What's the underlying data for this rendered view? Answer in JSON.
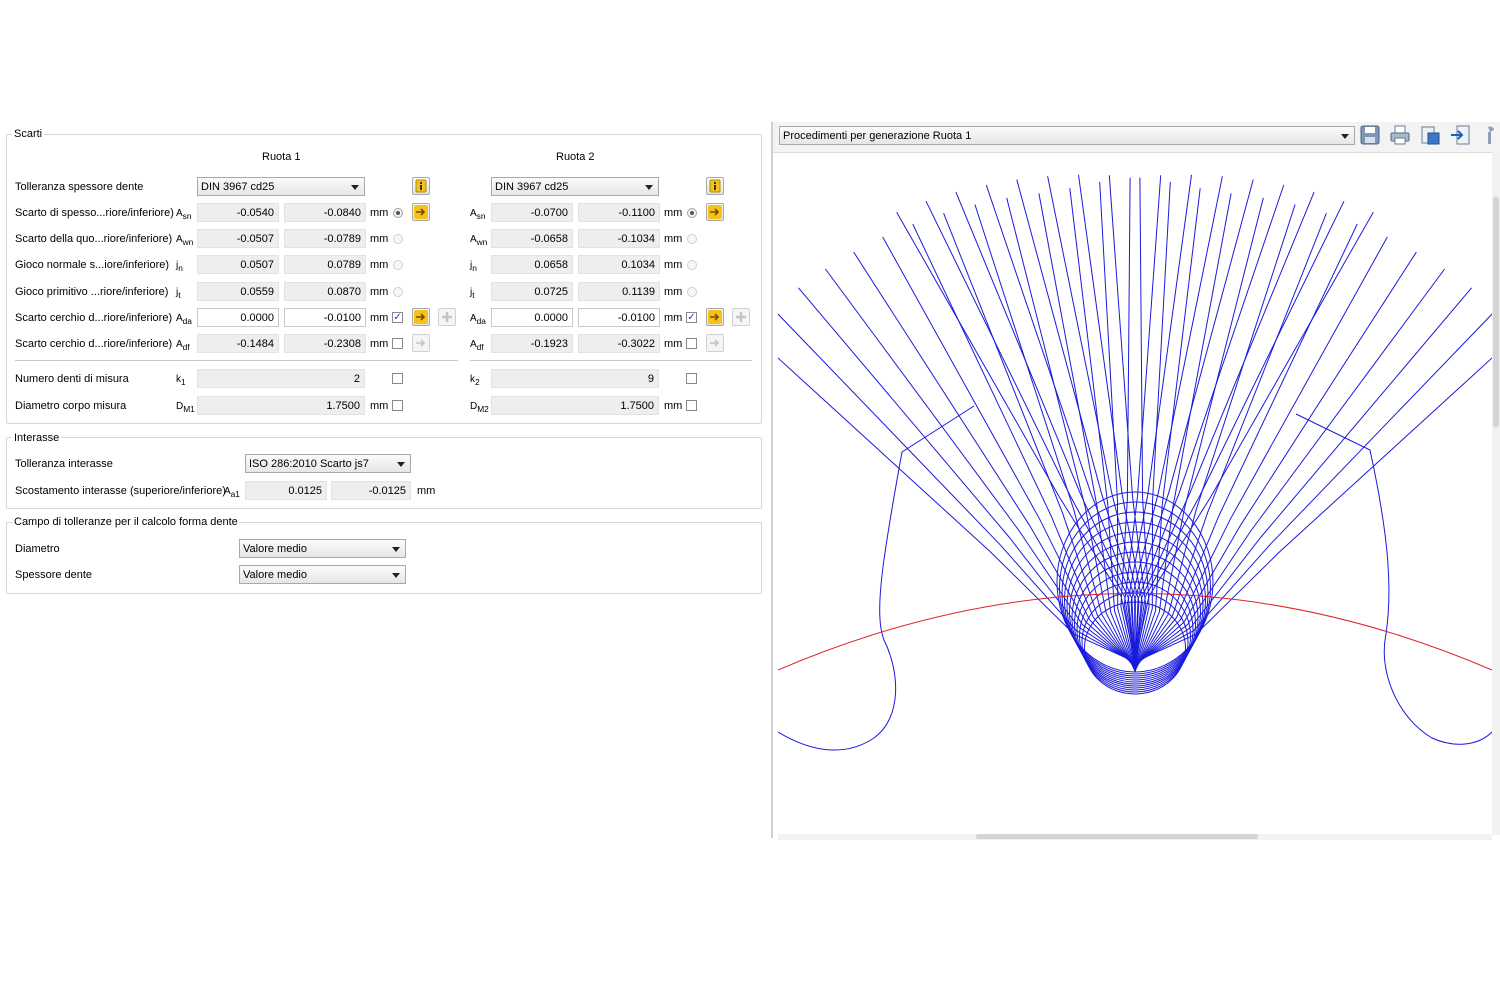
{
  "scarti": {
    "title": "Scarti",
    "ruota1": "Ruota 1",
    "ruota2": "Ruota 2",
    "rows": [
      {
        "label": "Tolleranza spessore dente",
        "combo1": "DIN 3967 cd25",
        "combo2": "DIN 3967 cd25"
      },
      {
        "label": "Scarto di spesso...riore/inferiore)",
        "sym": "Asn",
        "w1a": "-0.0540",
        "w1b": "-0.0840",
        "w2a": "-0.0700",
        "w2b": "-0.1100",
        "unit": "mm"
      },
      {
        "label": "Scarto della quo...riore/inferiore)",
        "sym": "Awn",
        "w1a": "-0.0507",
        "w1b": "-0.0789",
        "w2a": "-0.0658",
        "w2b": "-0.1034",
        "unit": "mm"
      },
      {
        "label": "Gioco normale s...iore/inferiore)",
        "sym": "jn",
        "w1a": "0.0507",
        "w1b": "0.0789",
        "w2a": "0.0658",
        "w2b": "0.1034",
        "unit": "mm"
      },
      {
        "label": "Gioco primitivo ...riore/inferiore)",
        "sym": "jt",
        "w1a": "0.0559",
        "w1b": "0.0870",
        "w2a": "0.0725",
        "w2b": "0.1139",
        "unit": "mm"
      },
      {
        "label": "Scarto cerchio d...riore/inferiore)",
        "sym": "Ada",
        "w1a": "0.0000",
        "w1b": "-0.0100",
        "w2a": "0.0000",
        "w2b": "-0.0100",
        "unit": "mm",
        "checked": true
      },
      {
        "label": "Scarto cerchio d...riore/inferiore)",
        "sym": "Adf",
        "w1a": "-0.1484",
        "w1b": "-0.2308",
        "w2a": "-0.1923",
        "w2b": "-0.3022",
        "unit": "mm",
        "checked": false
      }
    ],
    "k_label": "Numero denti di misura",
    "k1_sym": "k1",
    "k1": "2",
    "k2_sym": "k2",
    "k2": "9",
    "d_label": "Diametro corpo misura",
    "d1_sym": "DM1",
    "d1": "1.7500",
    "d2_sym": "DM2",
    "d2": "1.7500",
    "unit": "mm"
  },
  "interasse": {
    "title": "Interasse",
    "tol_label": "Tolleranza interasse",
    "tol_value": "ISO 286:2010 Scarto js7",
    "scost_label": "Scostamento interasse (superiore/inferiore)",
    "sym": "Aa1",
    "v1": "0.0125",
    "v2": "-0.0125",
    "unit": "mm"
  },
  "campo": {
    "title": "Campo di tolleranze per il calcolo forma dente",
    "diam_label": "Diametro",
    "diam_value": "Valore medio",
    "spess_label": "Spessore dente",
    "spess_value": "Valore medio"
  },
  "graphic": {
    "select_value": "Procedimenti per generazione Ruota 1",
    "toolbar_icons": [
      "save-icon",
      "print-icon",
      "copy-clipboard-icon",
      "export-icon",
      "settings-icon"
    ],
    "profile_color": "#1a1adc",
    "circle_color": "#e0212b"
  }
}
